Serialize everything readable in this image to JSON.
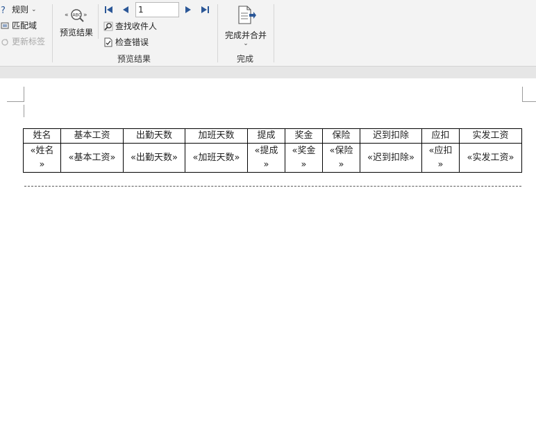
{
  "ribbon": {
    "rules_label": "规则",
    "match_fields_label": "匹配域",
    "update_labels_label": "更新标签",
    "preview_results_button": "预览结果",
    "record_number": "1",
    "find_recipient_label": "查找收件人",
    "check_errors_label": "检查错误",
    "preview_group_label": "预览结果",
    "finish_merge_button": "完成并合并",
    "finish_group_label": "完成"
  },
  "table": {
    "headers": [
      "姓名",
      "基本工资",
      "出勤天数",
      "加班天数",
      "提成",
      "奖金",
      "保险",
      "迟到扣除",
      "应扣",
      "实发工资"
    ],
    "fields": [
      [
        "«姓名",
        "»"
      ],
      [
        "«基本工资»"
      ],
      [
        "«出勤天数»"
      ],
      [
        "«加班天数»"
      ],
      [
        "«提成",
        "»"
      ],
      [
        "«奖金",
        "»"
      ],
      [
        "«保险",
        "»"
      ],
      [
        "«迟到扣除»"
      ],
      [
        "«应扣",
        "»"
      ],
      [
        "«实发工资»"
      ]
    ]
  }
}
